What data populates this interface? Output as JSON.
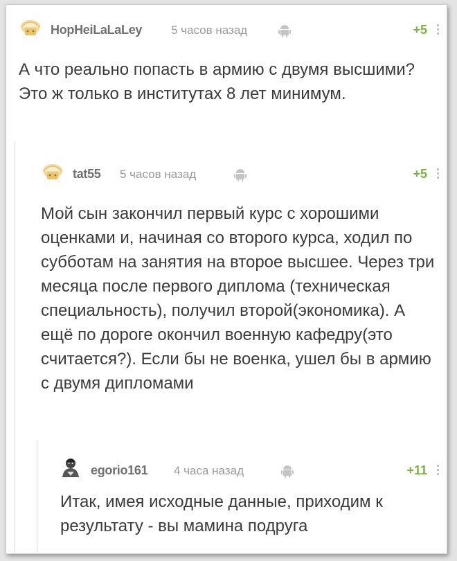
{
  "comments": [
    {
      "username": "HopHeiLaLaLey",
      "time": "5 часов назад",
      "rating": "+5",
      "text": "А что реально попасть в армию с двумя высшими? Это ж только в институтах 8 лет минимум.",
      "avatar_icon": "bread-avatar-icon",
      "device_icon": "android-icon"
    },
    {
      "username": "tat55",
      "time": "5 часов назад",
      "rating": "+5",
      "text": "Мой сын закончил первый курс с хорошими оценками и, начиная со второго курса, ходил по субботам на занятия на второе высшее. Через три месяца после первого диплома (техническая специальность), получил второй(экономика). А ещё по дороге окончил военную кафедру(это считается?). Если бы не военка, ушел бы в армию с двумя дипломами",
      "avatar_icon": "bread-avatar-icon",
      "device_icon": "android-icon"
    },
    {
      "username": "egorio161",
      "time": "4 часа назад",
      "rating": "+11",
      "text": "Итак, имея исходные данные, приходим к результату - вы мамина подруга",
      "avatar_icon": "character-avatar-icon",
      "device_icon": "android-icon"
    }
  ],
  "colors": {
    "rating": "#7cb342",
    "username": "#707070",
    "time": "#9a9a9a",
    "text": "#3b3b3b"
  }
}
